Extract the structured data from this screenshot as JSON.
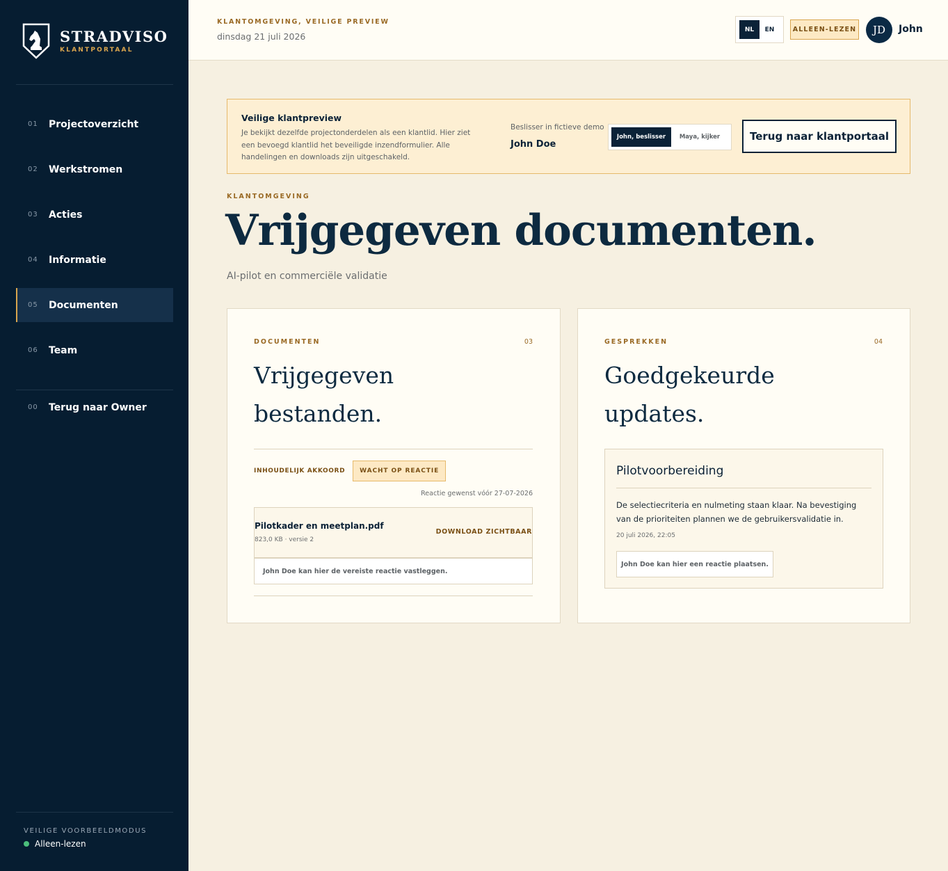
{
  "brand": {
    "name": "STRADVISO",
    "sub": "KLANTPORTAAL"
  },
  "sidebar": {
    "items": [
      {
        "num": "01",
        "label": "Projectoverzicht"
      },
      {
        "num": "02",
        "label": "Werkstromen"
      },
      {
        "num": "03",
        "label": "Acties"
      },
      {
        "num": "04",
        "label": "Informatie"
      },
      {
        "num": "05",
        "label": "Documenten"
      },
      {
        "num": "06",
        "label": "Team"
      }
    ],
    "active_index": 4,
    "back": {
      "num": "00",
      "label": "Terug naar Owner"
    },
    "mode_caption": "VEILIGE VOORBEELDMODUS",
    "mode_status": "Alleen-lezen"
  },
  "topbar": {
    "kicker": "KLANTOMGEVING, VEILIGE PREVIEW",
    "date": "dinsdag 21 juli 2026",
    "lang": [
      "NL",
      "EN"
    ],
    "lang_selected": "NL",
    "readonly": "ALLEEN-LEZEN",
    "avatar": "JD",
    "user": "John"
  },
  "banner": {
    "title": "Veilige klantpreview",
    "text": "Je bekijkt dezelfde projectonderdelen als een klantlid. Hier ziet een bevoegd klantlid het beveiligde inzendformulier. Alle handelingen en downloads zijn uitgeschakeld.",
    "role_caption": "Beslisser in fictieve demo",
    "role_name": "John Doe",
    "roles": [
      "John, beslisser",
      "Maya, kijker"
    ],
    "back_button": "Terug naar klantportaal"
  },
  "page": {
    "kicker": "KLANTOMGEVING",
    "title": "Vrijgegeven documenten.",
    "subtitle": "AI-pilot en commerciële validatie"
  },
  "documents_card": {
    "caption": "DOCUMENTEN",
    "count": "03",
    "title_line1": "Vrijgegeven",
    "title_line2": "bestanden.",
    "status_label": "INHOUDELIJK AKKOORD",
    "status_pill": "WACHT OP REACTIE",
    "due": "Reactie gewenst vóór 27-07-2026",
    "file": {
      "name": "Pilotkader en meetplan.pdf",
      "meta": "823,0 KB · versie 2",
      "download": "DOWNLOAD ZICHTBAAR"
    },
    "note": "John Doe kan hier de vereiste reactie vastleggen."
  },
  "updates_card": {
    "caption": "GESPREKKEN",
    "count": "04",
    "title_line1": "Goedgekeurde",
    "title_line2": "updates.",
    "update": {
      "title": "Pilotvoorbereiding",
      "text": "De selectiecriteria en nulmeting staan klaar. Na bevestiging van de prioriteiten plannen we de gebruikersvalidatie in.",
      "date": "20 juli 2026, 22:05",
      "react": "John Doe kan hier een reactie plaatsen."
    }
  },
  "colors": {
    "navy": "#061d31",
    "accent": "#d9a54e",
    "background": "#f6f0e1",
    "status_dot": "#4bbf7c"
  }
}
